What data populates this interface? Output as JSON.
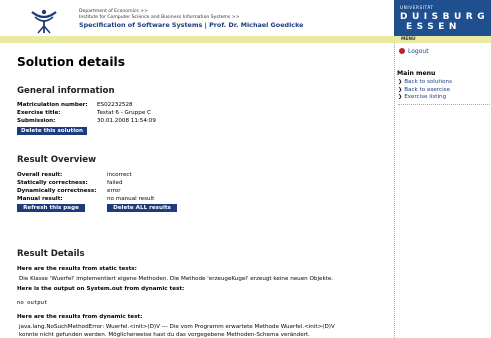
{
  "header": {
    "department_line1": "Department of Economics >>",
    "department_line2": "Institute for Computer Science and Business Information Systems >>",
    "spec_line": "Specification of Software Systems | Prof. Dr. Michael Goedicke",
    "university_label": "UNIVERSITÄT",
    "city_line1": "DUISBURG",
    "city_line2": "ESSEN"
  },
  "sidebar": {
    "menu_label": "MENU",
    "logout_label": "Logout",
    "main_menu_label": "Main menu",
    "items": [
      {
        "label": "Back to solutions"
      },
      {
        "label": "Back to exercise"
      },
      {
        "label": "Exercise listing"
      }
    ]
  },
  "main": {
    "title": "Solution details",
    "general_heading": "General information",
    "matriculation_label": "Matriculation number:",
    "matriculation_value": "ES02232528",
    "exercise_label": "Exercise title:",
    "exercise_value": "Testat 6 - Gruppe C",
    "submission_label": "Submission:",
    "submission_value": "30.01.2008 11:54:09",
    "delete_solution_label": "Delete this solution",
    "overview_heading": "Result Overview",
    "overall_label": "Overall result:",
    "overall_value": "incorrect",
    "static_label": "Statically correctness:",
    "static_value": "failed",
    "dynamic_label": "Dynamically correctness:",
    "dynamic_value": "error",
    "manual_label": "Manual result:",
    "manual_value": "no manual result",
    "refresh_label": "Refresh this page",
    "delete_all_label": "Delete ALL results",
    "details_heading": "Result Details",
    "static_tests_label": "Here are the results from static tests:",
    "static_tests_text": "Die Klasse 'Wuerfel' implementiert eigene Methoden. Die Methode 'erzeugeKugel' erzeugt keine neuen Objekte.",
    "system_out_label": "Here is the output on System.out from dynamic test:",
    "system_out_text": "no output",
    "dynamic_tests_label": "Here are the results from dynamic test:",
    "dynamic_tests_text1": "java.lang.NoSuchMethodError: Wuerfel.<init>(D)V --- Die vom Programm erwartete Methode Wuerfel.<init>(D)V",
    "dynamic_tests_text2": "konnte nicht gefunden werden. Möglicherweise hast du das vorgegebene Methoden-Schema verändert."
  },
  "colors": {
    "brand_blue": "#1d3c7e",
    "menu_bar": "#eaeaa2",
    "logo_blue": "#1f4f8f",
    "logout_dot": "#b4272c"
  }
}
